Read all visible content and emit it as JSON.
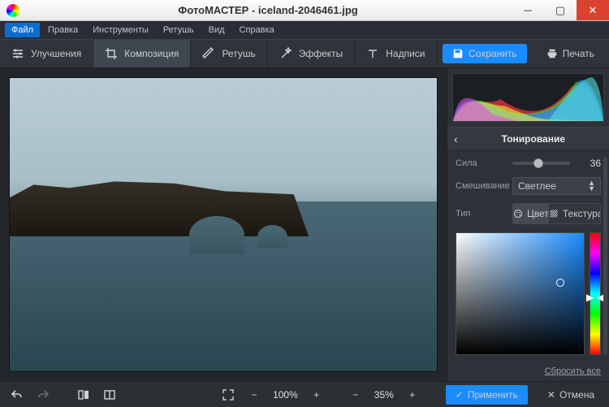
{
  "window": {
    "app_name": "ФотоМАСТЕР",
    "file_name": "iceland-2046461.jpg",
    "title": "ФотоМАСТЕР - iceland-2046461.jpg"
  },
  "menu": {
    "items": [
      "Файл",
      "Правка",
      "Инструменты",
      "Ретушь",
      "Вид",
      "Справка"
    ],
    "active_index": 0
  },
  "tabs": {
    "items": [
      {
        "label": "Улучшения",
        "icon": "sliders-icon"
      },
      {
        "label": "Композиция",
        "icon": "crop-icon"
      },
      {
        "label": "Ретушь",
        "icon": "brush-icon"
      },
      {
        "label": "Эффекты",
        "icon": "wand-icon"
      },
      {
        "label": "Надписи",
        "icon": "text-icon"
      }
    ],
    "active_index": 1
  },
  "actions": {
    "save": "Сохранить",
    "print": "Печать"
  },
  "panel": {
    "title": "Тонирование",
    "strength": {
      "label": "Сила",
      "value": 36,
      "min": 0,
      "max": 100
    },
    "blend": {
      "label": "Смешивание",
      "value": "Светлее"
    },
    "type": {
      "label": "Тип",
      "options": [
        {
          "label": "Цвет",
          "active": true
        },
        {
          "label": "Текстура",
          "active": false
        }
      ]
    },
    "color": {
      "hue": 220,
      "sat": 80,
      "val": 70,
      "hex": "#1a8cff"
    },
    "reset": "Сбросить все"
  },
  "status": {
    "zoom_fit": "100%",
    "zoom_current": "35%",
    "apply": "Применить",
    "cancel": "Отмена"
  }
}
